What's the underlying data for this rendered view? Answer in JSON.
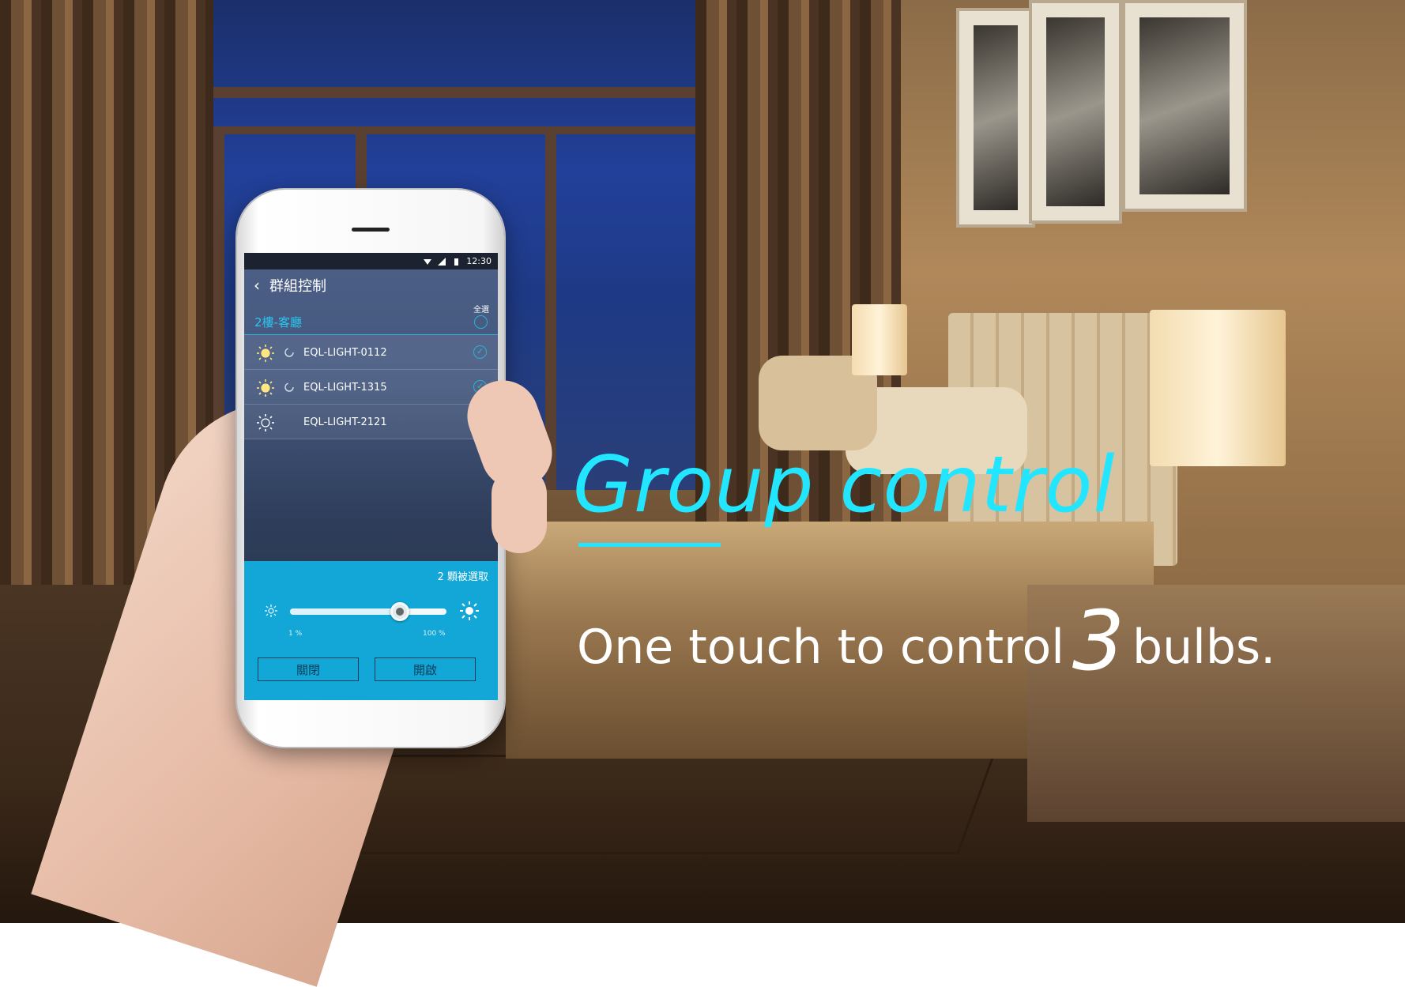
{
  "status_bar": {
    "time": "12:30",
    "icons": [
      "wifi-icon",
      "signal-icon",
      "battery-icon"
    ]
  },
  "app_bar": {
    "back_icon": "chevron-left-icon",
    "title": "群組控制"
  },
  "group": {
    "name": "2樓-客廳",
    "select_all_label": "全選",
    "select_all_checked": false
  },
  "devices": [
    {
      "name": "EQL-LIGHT-0112",
      "on": true,
      "loading": true,
      "selected": true
    },
    {
      "name": "EQL-LIGHT-1315",
      "on": true,
      "loading": true,
      "selected": true
    },
    {
      "name": "EQL-LIGHT-2121",
      "on": false,
      "loading": false,
      "selected": false
    }
  ],
  "control_panel": {
    "selected_count_text": "2 顆被選取",
    "brightness_fraction": 0.7,
    "min_label": "1 %",
    "max_label": "100 %",
    "off_label": "關閉",
    "on_label": "開啟"
  },
  "headline": "Group control",
  "subline": {
    "before": "One touch to control",
    "number": "3",
    "after": "bulbs."
  },
  "colors": {
    "accent": "#22e6ff",
    "panel": "#12a7d6",
    "list_accent": "#29c7f0"
  }
}
